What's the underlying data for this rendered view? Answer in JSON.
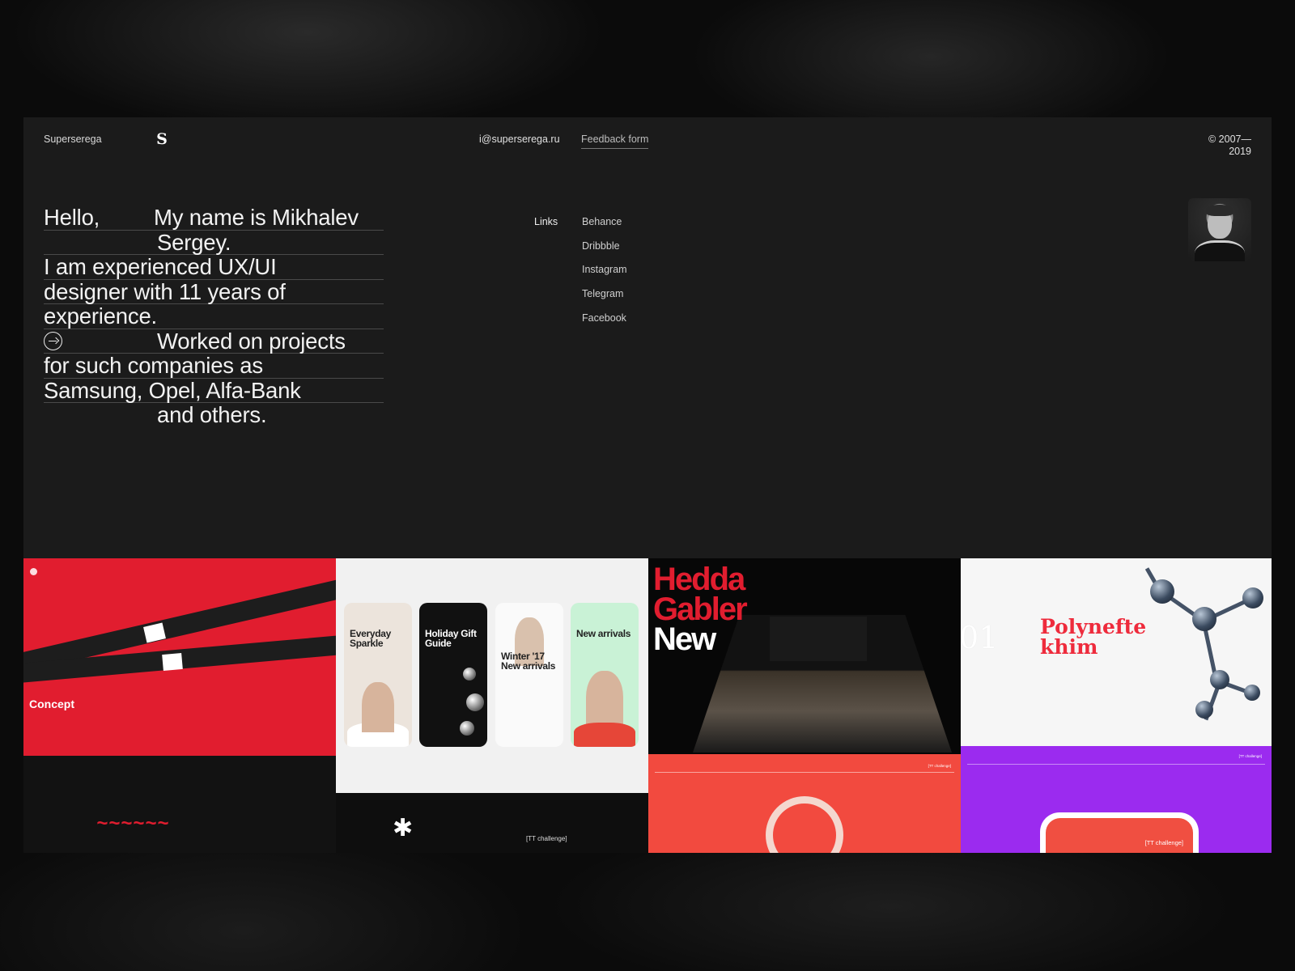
{
  "header": {
    "brand": "Superserega",
    "logo_glyph": "S",
    "email": "i@superserega.ru",
    "feedback": "Feedback form",
    "copyright_line1": "© 2007—",
    "copyright_line2": "2019"
  },
  "intro": {
    "line1a": "Hello,",
    "line1b": "My name is Mikhalev",
    "line2": "Sergey.",
    "line3": "I am experienced UX/UI",
    "line4": "designer with 11 years of",
    "line5": "experience.",
    "line6": "Worked on projects",
    "line7": "for such companies as",
    "line8": "Samsung, Opel, Alfa-Bank",
    "line9": "and others."
  },
  "links": {
    "label": "Links",
    "items": [
      "Behance",
      "Dribbble",
      "Instagram",
      "Telegram",
      "Facebook"
    ]
  },
  "projects": {
    "concept": {
      "title": "Concept",
      "accent": "#e11d2f"
    },
    "shop": {
      "phone1": "Everyday Sparkle",
      "phone2": "Holiday Gift Guide",
      "phone3": "Winter '17 New arrivals",
      "phone4": "New arrivals",
      "challenge": "[TT challenge]"
    },
    "hedda": {
      "line1": "Hedda",
      "line2": "Gabler",
      "line3": "New"
    },
    "polynefte": {
      "line1": "Polynefte",
      "line2": "khim",
      "number": "01"
    },
    "challenge_label": "[TT challenge]"
  },
  "colors": {
    "background": "#1b1b1b",
    "red": "#e11d2f",
    "purple": "#9b2bef",
    "coral": "#f24a3f"
  }
}
